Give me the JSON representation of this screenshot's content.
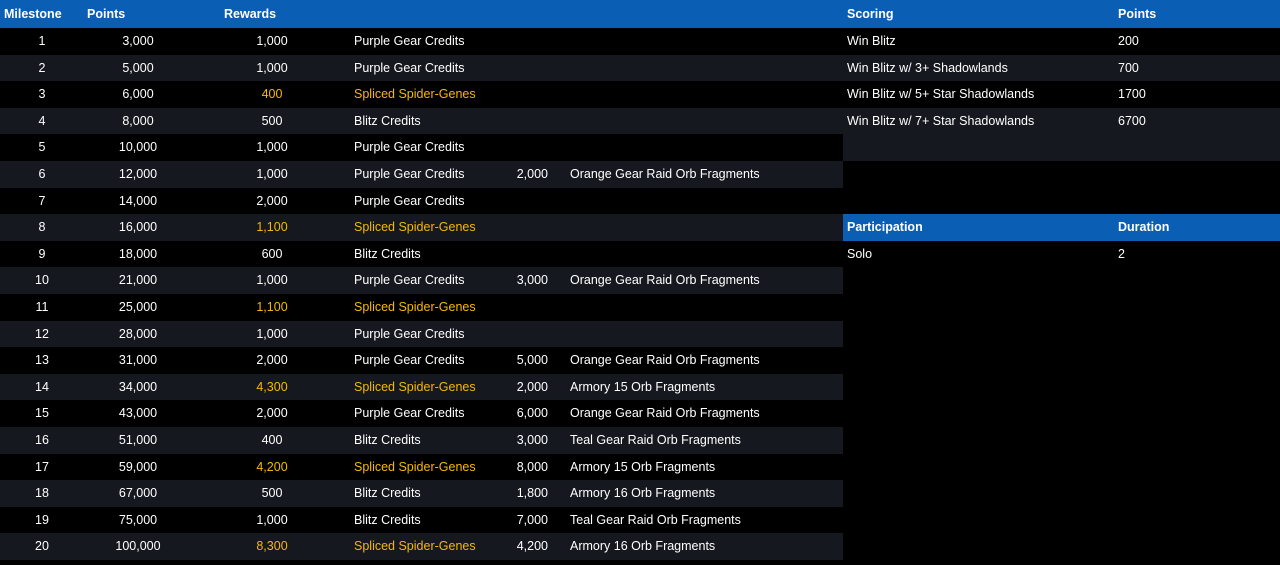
{
  "colors": {
    "header_bg": "#0a5fb4",
    "row_dark": "#000000",
    "row_alt": "#15191f",
    "text": "#ffffff",
    "highlight": "#f5b800"
  },
  "milestones": {
    "headers": {
      "milestone": "Milestone",
      "points": "Points",
      "rewards": "Rewards"
    },
    "rows": [
      {
        "milestone": "1",
        "points": "3,000",
        "amount": "1,000",
        "reward": "Purple Gear Credits",
        "highlight": false,
        "amount2": "",
        "reward2": ""
      },
      {
        "milestone": "2",
        "points": "5,000",
        "amount": "1,000",
        "reward": "Purple Gear Credits",
        "highlight": false,
        "amount2": "",
        "reward2": ""
      },
      {
        "milestone": "3",
        "points": "6,000",
        "amount": "400",
        "reward": "Spliced Spider-Genes",
        "highlight": true,
        "amount2": "",
        "reward2": ""
      },
      {
        "milestone": "4",
        "points": "8,000",
        "amount": "500",
        "reward": "Blitz Credits",
        "highlight": false,
        "amount2": "",
        "reward2": ""
      },
      {
        "milestone": "5",
        "points": "10,000",
        "amount": "1,000",
        "reward": "Purple Gear Credits",
        "highlight": false,
        "amount2": "",
        "reward2": ""
      },
      {
        "milestone": "6",
        "points": "12,000",
        "amount": "1,000",
        "reward": "Purple Gear Credits",
        "highlight": false,
        "amount2": "2,000",
        "reward2": "Orange Gear Raid Orb Fragments"
      },
      {
        "milestone": "7",
        "points": "14,000",
        "amount": "2,000",
        "reward": "Purple Gear Credits",
        "highlight": false,
        "amount2": "",
        "reward2": ""
      },
      {
        "milestone": "8",
        "points": "16,000",
        "amount": "1,100",
        "reward": "Spliced Spider-Genes",
        "highlight": true,
        "amount2": "",
        "reward2": ""
      },
      {
        "milestone": "9",
        "points": "18,000",
        "amount": "600",
        "reward": "Blitz Credits",
        "highlight": false,
        "amount2": "",
        "reward2": ""
      },
      {
        "milestone": "10",
        "points": "21,000",
        "amount": "1,000",
        "reward": "Purple Gear Credits",
        "highlight": false,
        "amount2": "3,000",
        "reward2": "Orange Gear Raid Orb Fragments"
      },
      {
        "milestone": "11",
        "points": "25,000",
        "amount": "1,100",
        "reward": "Spliced Spider-Genes",
        "highlight": true,
        "amount2": "",
        "reward2": ""
      },
      {
        "milestone": "12",
        "points": "28,000",
        "amount": "1,000",
        "reward": "Purple Gear Credits",
        "highlight": false,
        "amount2": "",
        "reward2": ""
      },
      {
        "milestone": "13",
        "points": "31,000",
        "amount": "2,000",
        "reward": "Purple Gear Credits",
        "highlight": false,
        "amount2": "5,000",
        "reward2": "Orange Gear Raid Orb Fragments"
      },
      {
        "milestone": "14",
        "points": "34,000",
        "amount": "4,300",
        "reward": "Spliced Spider-Genes",
        "highlight": true,
        "amount2": "2,000",
        "reward2": "Armory 15 Orb Fragments"
      },
      {
        "milestone": "15",
        "points": "43,000",
        "amount": "2,000",
        "reward": "Purple Gear Credits",
        "highlight": false,
        "amount2": "6,000",
        "reward2": "Orange Gear Raid Orb Fragments"
      },
      {
        "milestone": "16",
        "points": "51,000",
        "amount": "400",
        "reward": "Blitz Credits",
        "highlight": false,
        "amount2": "3,000",
        "reward2": "Teal Gear Raid Orb Fragments"
      },
      {
        "milestone": "17",
        "points": "59,000",
        "amount": "4,200",
        "reward": "Spliced Spider-Genes",
        "highlight": true,
        "amount2": "8,000",
        "reward2": "Armory 15 Orb Fragments"
      },
      {
        "milestone": "18",
        "points": "67,000",
        "amount": "500",
        "reward": "Blitz Credits",
        "highlight": false,
        "amount2": "1,800",
        "reward2": "Armory 16 Orb Fragments"
      },
      {
        "milestone": "19",
        "points": "75,000",
        "amount": "1,000",
        "reward": "Blitz Credits",
        "highlight": false,
        "amount2": "7,000",
        "reward2": "Teal Gear Raid Orb Fragments"
      },
      {
        "milestone": "20",
        "points": "100,000",
        "amount": "8,300",
        "reward": "Spliced Spider-Genes",
        "highlight": true,
        "amount2": "4,200",
        "reward2": "Armory 16 Orb Fragments"
      }
    ]
  },
  "scoring": {
    "headers": {
      "scoring": "Scoring",
      "points": "Points"
    },
    "rows": [
      {
        "label": "Win Blitz",
        "points": "200"
      },
      {
        "label": "Win Blitz w/ 3+ Shadowlands",
        "points": "700"
      },
      {
        "label": "Win Blitz w/ 5+ Star Shadowlands",
        "points": "1700"
      },
      {
        "label": "Win Blitz w/ 7+ Star Shadowlands",
        "points": "6700"
      }
    ]
  },
  "participation": {
    "headers": {
      "participation": "Participation",
      "duration": "Duration"
    },
    "rows": [
      {
        "type": "Solo",
        "duration": "2"
      }
    ]
  }
}
